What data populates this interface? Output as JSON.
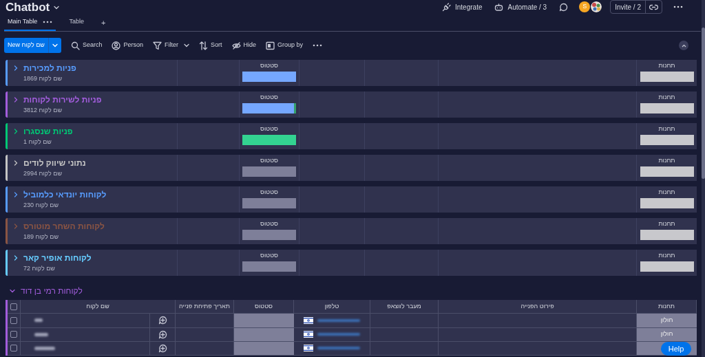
{
  "board": {
    "title": "Chatbot"
  },
  "tabs": [
    {
      "label": "Table",
      "selected": false
    },
    {
      "label": "Main Table",
      "selected": true
    }
  ],
  "add_view": "+",
  "toolbar": {
    "new_button": "New שם לקוח",
    "items": [
      {
        "kind": "group",
        "label": "Group by"
      },
      {
        "kind": "hide",
        "label": "Hide"
      },
      {
        "kind": "sort",
        "label": "Sort"
      },
      {
        "kind": "filter",
        "label": "Filter"
      },
      {
        "kind": "person",
        "label": "Person"
      },
      {
        "kind": "search",
        "label": "Search"
      }
    ]
  },
  "header_actions": [
    {
      "kind": "automate",
      "label": "Automate / 3"
    },
    {
      "kind": "integrate",
      "label": "Integrate"
    }
  ],
  "avatars": [
    {
      "kind": "initial",
      "initial": "S"
    },
    {
      "kind": "picture"
    }
  ],
  "invite": "Invite / 2",
  "groups": [
    {
      "title": "פניות למכירות",
      "color": "#579bfc",
      "expanded": false,
      "count": "שם לקוח 1869",
      "status_label": "סטטוס",
      "status_segments": [
        {
          "color": "#75a7ff",
          "level": 1
        }
      ],
      "tags_label": "תחנות"
    },
    {
      "title": "פניות לשירות לקוחות",
      "color": "#a25ddc",
      "expanded": false,
      "count": "שם לקוח 3812",
      "status_label": "סטטוס",
      "status_segments": [
        {
          "color": "#75a7ff",
          "level": 0.96
        },
        {
          "color": "#33a06a",
          "level": 0.04
        }
      ],
      "tags_label": "תחנות"
    },
    {
      "title": "פניות שנסגרו",
      "color": "#00c875",
      "expanded": false,
      "count": "שם לקוח 1",
      "status_label": "סטטוס",
      "status_segments": [
        {
          "color": "#33d391",
          "level": 1
        }
      ],
      "tags_label": "תחנות"
    },
    {
      "title": "נתוני שיווק לודים",
      "color": "#c4c4c4",
      "expanded": false,
      "count": "שם לקוח 2994",
      "status_label": "סטטוס",
      "status_segments": [
        {
          "color": "#7e7f99",
          "level": 1
        }
      ],
      "tags_label": "תחנות"
    },
    {
      "title": "לקוחות יונדאי כלמוביל",
      "color": "#579bfc",
      "expanded": false,
      "count": "שם לקוח 230",
      "status_label": "סטטוס",
      "status_segments": [
        {
          "color": "#7e7f99",
          "level": 1
        }
      ],
      "tags_label": "תחנות"
    },
    {
      "title": "לקוחות השחר מוטורס",
      "color": "#8a5443",
      "expanded": false,
      "count": "שם לקוח 189",
      "status_label": "סטטוס",
      "status_segments": [
        {
          "color": "#7e7f99",
          "level": 1
        }
      ],
      "tags_label": "תחנות"
    },
    {
      "title": "לקוחות אופיר קאר",
      "color": "#66ccff",
      "expanded": false,
      "count": "שם לקוח 72",
      "status_label": "סטטוס",
      "status_segments": [
        {
          "color": "#7e7f99",
          "level": 1
        }
      ],
      "tags_label": "תחנות"
    },
    {
      "title": "לקוחות רמי בן דוד",
      "color": "#a25ddc",
      "expanded": true,
      "columns": [
        "תחנות",
        "פירוט הפנייה",
        "מעבר לווצאפ",
        "טלפון",
        "סטטוס",
        "תאריך פתיחת פנייה",
        "שם לקוח"
      ],
      "all_checked": false,
      "rows": [
        {
          "checked": false,
          "tags": "חולון"
        },
        {
          "checked": false,
          "tags": "חולון"
        },
        {
          "checked": false
        }
      ]
    }
  ],
  "help": "Help"
}
